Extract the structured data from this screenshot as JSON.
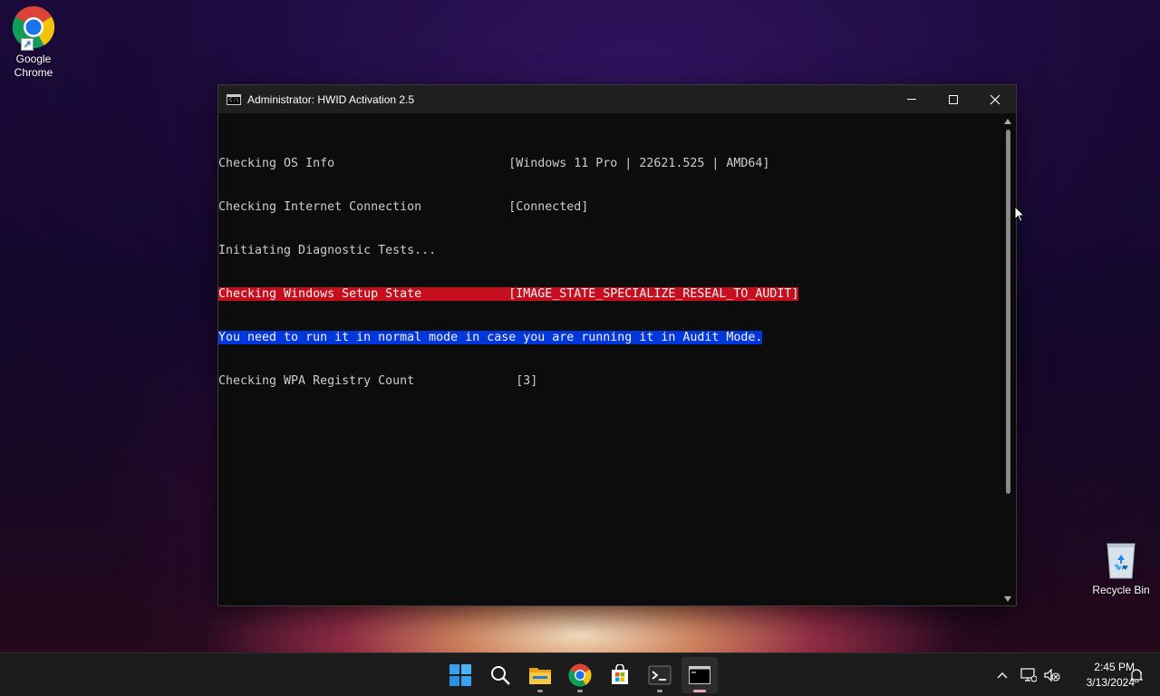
{
  "desktop": {
    "icons": [
      {
        "label_line1": "Google",
        "label_line2": "Chrome"
      },
      {
        "label": "Recycle Bin"
      }
    ]
  },
  "window": {
    "title": "Administrator:  HWID Activation 2.5",
    "controls": {
      "minimize": "minimize-icon",
      "maximize": "maximize-icon",
      "close": "close-icon"
    }
  },
  "console": {
    "lines": [
      "Checking OS Info                        [Windows 11 Pro | 22621.525 | AMD64]",
      "Checking Internet Connection            [Connected]",
      "Initiating Diagnostic Tests...",
      "Checking Windows Setup State            [IMAGE_STATE_SPECIALIZE_RESEAL_TO_AUDIT]",
      "You need to run it in normal mode in case you are running it in Audit Mode.",
      "Checking WPA Registry Count              [3]"
    ],
    "highlight_colors": {
      "error": "#c50f1f",
      "info": "#0037da"
    }
  },
  "taskbar": {
    "apps": [
      {
        "name": "start",
        "icon": "windows-logo-icon"
      },
      {
        "name": "search",
        "icon": "search-icon"
      },
      {
        "name": "file-explorer",
        "icon": "folder-icon"
      },
      {
        "name": "chrome",
        "icon": "chrome-icon"
      },
      {
        "name": "store",
        "icon": "store-icon"
      },
      {
        "name": "terminal",
        "icon": "terminal-icon"
      },
      {
        "name": "command-prompt",
        "icon": "cmd-icon"
      }
    ],
    "clock": {
      "time": "2:45 PM",
      "date": "3/13/2024"
    }
  },
  "colors": {
    "accent": "#0078d4",
    "titlebar": "#1f1f1f",
    "console_bg": "#0c0c0c"
  }
}
